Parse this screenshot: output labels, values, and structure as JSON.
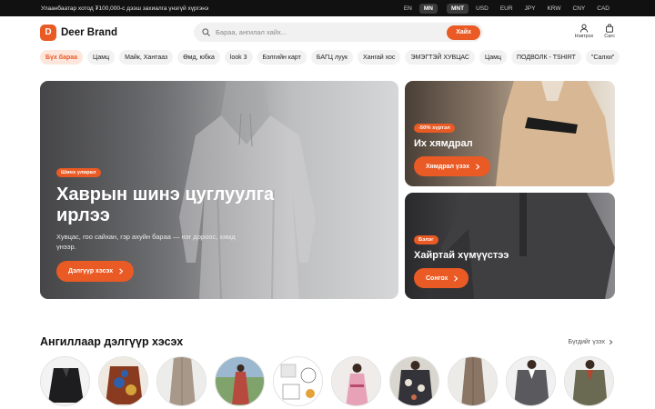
{
  "topbar": {
    "announcement": "Улаанбаатар хотод ₮100,000-с дээш захиалга үнэгүй хүргэнэ",
    "languages": [
      {
        "label": "EN",
        "active": false
      },
      {
        "label": "MN",
        "active": true
      }
    ],
    "currencies": [
      {
        "label": "MNT",
        "active": true
      },
      {
        "label": "USD",
        "active": false
      },
      {
        "label": "EUR",
        "active": false
      },
      {
        "label": "JPY",
        "active": false
      },
      {
        "label": "KRW",
        "active": false
      },
      {
        "label": "CNY",
        "active": false
      },
      {
        "label": "CAD",
        "active": false
      }
    ]
  },
  "header": {
    "logo_letter": "D",
    "brand": "Deer Brand",
    "search_placeholder": "Бараа, ангилал хайх...",
    "search_button": "Хайх",
    "login_label": "Нэвтрэх",
    "cart_label": "Сагс"
  },
  "chips": [
    "Бүх бараа",
    "Цамц",
    "Майк, Хантааз",
    "Өмд, юбка",
    "look 3",
    "Бэлгийн карт",
    "БАГЦ луук",
    "Хангай хос",
    "ЭМЭГТЭЙ ХУВЦАС",
    "Цамц",
    "ПОДВОЛК - TSHIRT",
    "\"Салхи\""
  ],
  "hero": {
    "badge": "Шинэ улирал",
    "title": "Хаврын шинэ цуглуулга ирлээ",
    "subtitle": "Хувцас, гоо сайхан, гэр ахуйн бараа — нэг дороос, хямд үнээр.",
    "cta": "Дэлгүүр хэсэх"
  },
  "promo_a": {
    "badge": "-50% хүртэл",
    "title": "Их хямдрал",
    "cta": "Хямдрал үзэх"
  },
  "promo_b": {
    "badge": "Бэлэг",
    "title": "Хайртай хүмүүстээ",
    "cta": "Сонгох"
  },
  "section": {
    "title": "Ангиллаар дэлгүүр хэсэх",
    "see_all": "Бүгдийг үзэх"
  },
  "categories": [
    {
      "name": "black-jacket"
    },
    {
      "name": "patterned-jacket"
    },
    {
      "name": "beige-skirt"
    },
    {
      "name": "deel-field"
    },
    {
      "name": "illustration-sheet"
    },
    {
      "name": "pink-deel"
    },
    {
      "name": "floral-shirt"
    },
    {
      "name": "brown-skirt"
    },
    {
      "name": "grey-shirt"
    },
    {
      "name": "olive-shirt"
    }
  ],
  "colors": {
    "accent": "#ea5a24",
    "topbar_bg": "#111111"
  }
}
